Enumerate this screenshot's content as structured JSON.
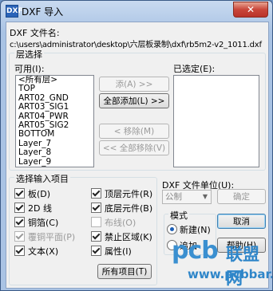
{
  "window": {
    "title": "DXF 导入",
    "icon_label": "DXF",
    "close_label": "✕"
  },
  "file": {
    "label": "DXF 文件名:",
    "path": "c:\\users\\administrator\\desktop\\六层板录制\\dxf\\rb5m2-v2_1011.dxf"
  },
  "layer_select": {
    "group_label": "层选择",
    "available_label": "可用(I):",
    "selected_label": "已选定(E):",
    "available_items": [
      "<所有层>",
      "TOP",
      "ART02_GND",
      "ART03_SIG1",
      "ART04_PWR",
      "ART05_SIG2",
      "BOTTOM",
      "Layer_7",
      "Layer_8",
      "Layer_9"
    ],
    "buttons": {
      "add": "添(A) >>",
      "add_all": "全部添加(L) >>",
      "remove": "< 移除(M)",
      "remove_all": "<< 全部移除(V)"
    }
  },
  "import_items": {
    "group_label": "选择输入项目",
    "items": [
      {
        "label": "板(D)",
        "checked": true,
        "enabled": true
      },
      {
        "label": "2D 线",
        "checked": true,
        "enabled": true
      },
      {
        "label": "铜箔(C)",
        "checked": true,
        "enabled": true
      },
      {
        "label": "覆铜平面(P)",
        "checked": true,
        "enabled": false
      },
      {
        "label": "文本(X)",
        "checked": true,
        "enabled": true
      },
      {
        "label": "顶层元件(R)",
        "checked": true,
        "enabled": true
      },
      {
        "label": "底层元件(B)",
        "checked": true,
        "enabled": true
      },
      {
        "label": "布线(O)",
        "checked": false,
        "enabled": false
      },
      {
        "label": "禁止区域(K)",
        "checked": true,
        "enabled": true
      },
      {
        "label": "属性(I)",
        "checked": true,
        "enabled": true
      }
    ],
    "all_items_button": "所有项目(T)"
  },
  "units": {
    "label": "DXF 文件单位(U):",
    "value": "公制",
    "ok_button": "确定"
  },
  "mode": {
    "group_label": "模式",
    "new_label": "新建(N)",
    "append_label": "追加",
    "new_selected": true
  },
  "buttons": {
    "cancel": "取消",
    "help": "帮助(H)"
  },
  "watermark": {
    "logo": "pcb",
    "cn": "联盟网",
    "url": "www.pcbbar.com"
  }
}
